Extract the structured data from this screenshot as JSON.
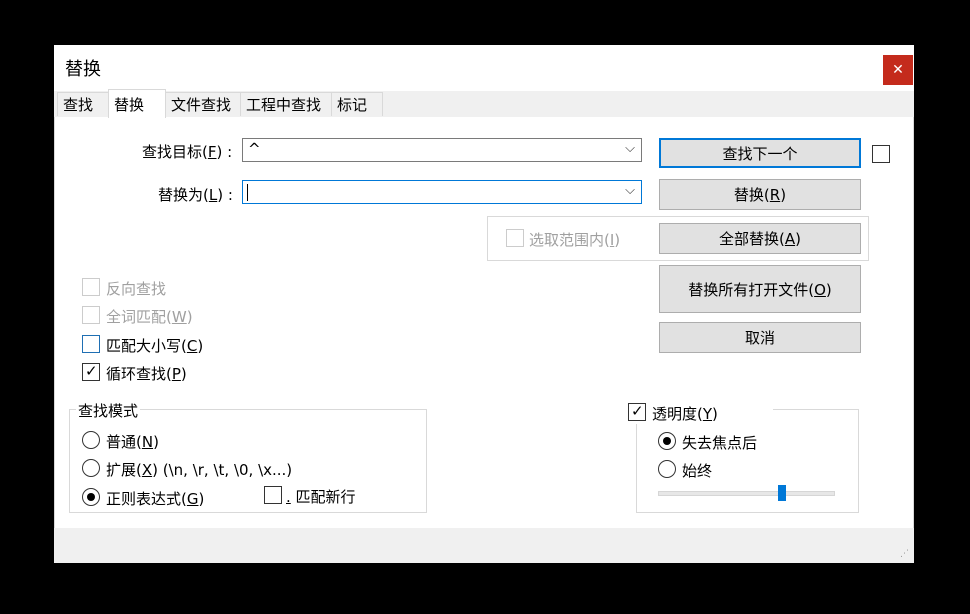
{
  "window": {
    "title": "替换",
    "close_glyph": "✕"
  },
  "tabs": [
    {
      "label": "查找"
    },
    {
      "label": "替换"
    },
    {
      "label": "文件查找"
    },
    {
      "label": "工程中查找"
    },
    {
      "label": "标记"
    }
  ],
  "find": {
    "label_pre": "查找目标(",
    "label_key": "F",
    "label_post": ") :",
    "value": "^",
    "arrow": "⌵"
  },
  "replace": {
    "label_pre": "替换为(",
    "label_key": "L",
    "label_post": ") :",
    "value": "",
    "arrow": "⌵"
  },
  "buttons": {
    "find_next": "查找下一个",
    "replace_pre": "替换(",
    "replace_key": "R",
    "replace_post": ")",
    "replace_all_pre": "全部替换(",
    "replace_all_key": "A",
    "replace_all_post": ")",
    "replace_all_open_pre": "替换所有打开文件(",
    "replace_all_open_key": "O",
    "replace_all_open_post": ")",
    "cancel": "取消"
  },
  "in_selection": {
    "pre": "选取范围内(",
    "key": "I",
    "post": ")",
    "checked": false,
    "enabled": false
  },
  "options": {
    "backward": {
      "label": "反向查找",
      "checked": false,
      "enabled": false
    },
    "whole_word": {
      "pre": "全词匹配(",
      "key": "W",
      "post": ")",
      "checked": false,
      "enabled": false
    },
    "match_case": {
      "pre": "匹配大小写(",
      "key": "C",
      "post": ")",
      "checked": false,
      "enabled": true
    },
    "wrap": {
      "pre": "循环查找(",
      "key": "P",
      "post": ")",
      "checked": true,
      "enabled": true,
      "tick": "✓"
    }
  },
  "search_mode": {
    "title": "查找模式",
    "normal": {
      "pre": "普通(",
      "key": "N",
      "post": ")"
    },
    "extended": {
      "pre": "扩展(",
      "key": "X",
      "post": ") (\\n, \\r, \\t, \\0, \\x...)"
    },
    "regex": {
      "pre": "正则表达式(",
      "key": "G",
      "post": ")"
    },
    "selected": "regex",
    "dot_newline": {
      "key": ".",
      "label": " 匹配新行",
      "checked": false
    }
  },
  "transparency": {
    "pre": "透明度(",
    "key": "Y",
    "post": ")",
    "checked": true,
    "tick": "✓",
    "on_lose_focus": "失去焦点后",
    "always": "始终",
    "selected": "on_lose_focus",
    "level": 0.7
  }
}
